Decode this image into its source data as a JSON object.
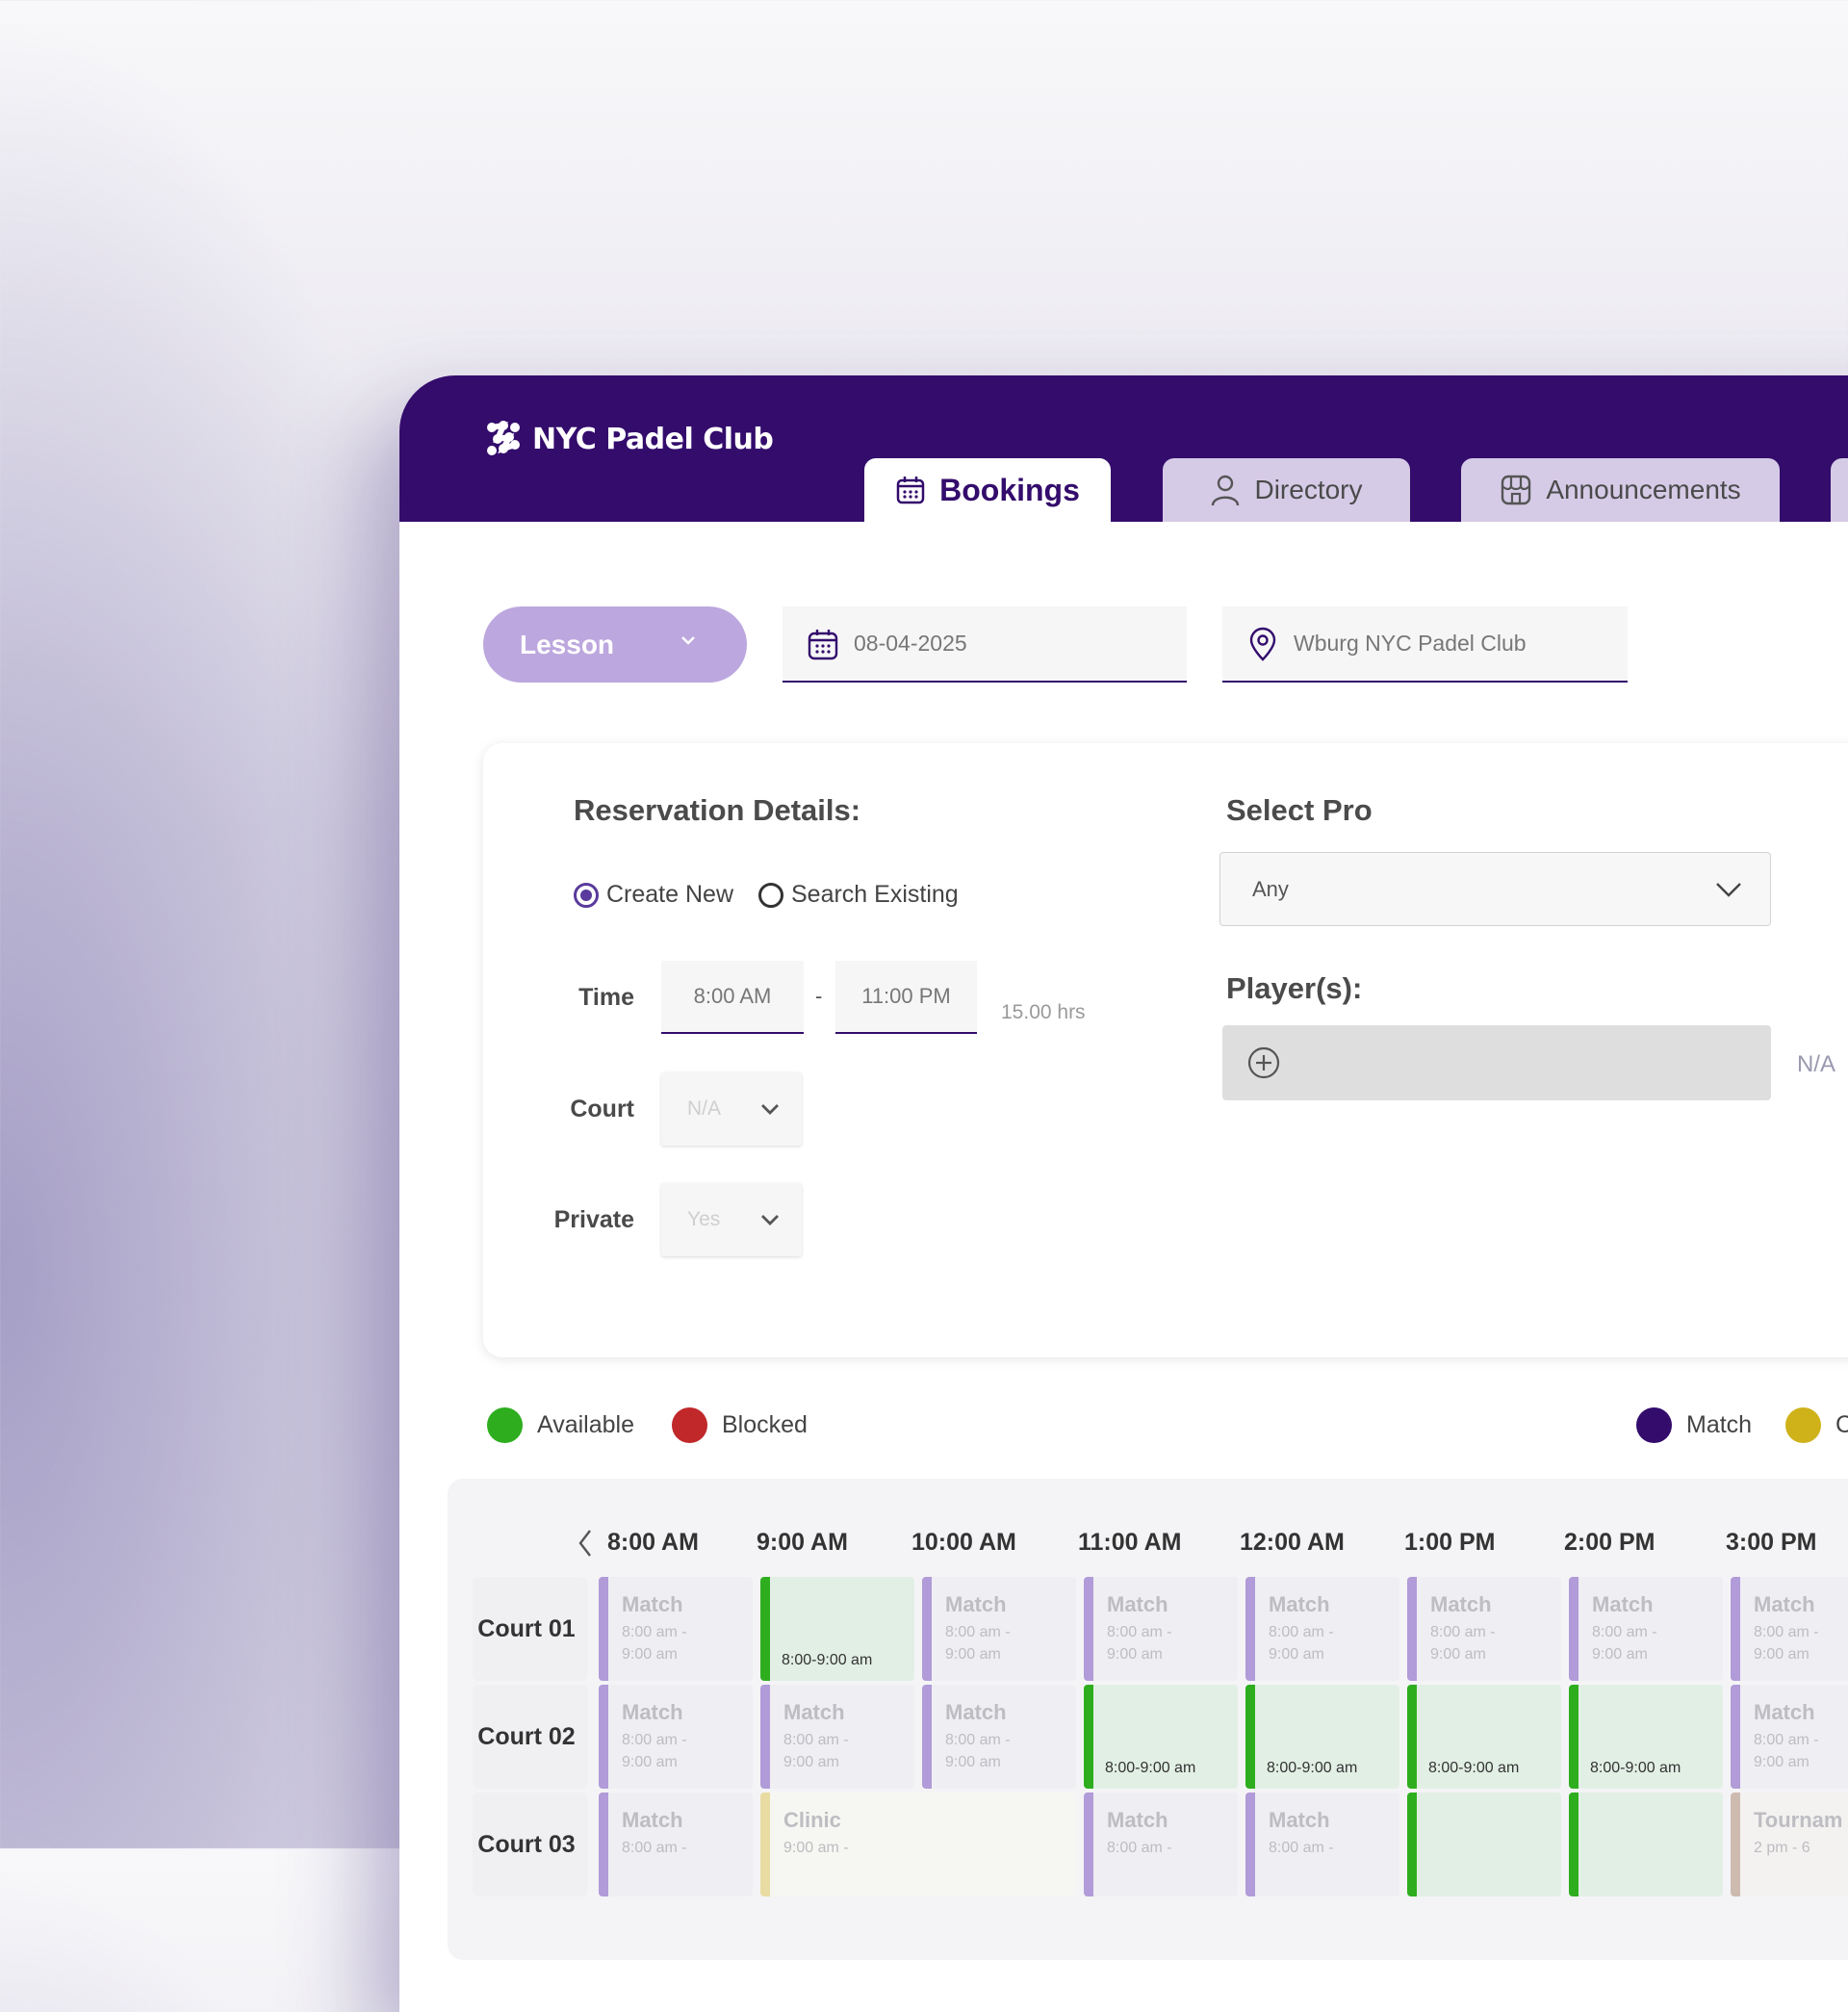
{
  "app": {
    "name": "NYC Padel Club"
  },
  "tabs": [
    {
      "label": "Bookings",
      "active": true,
      "icon": "calendar-icon"
    },
    {
      "label": "Directory",
      "active": false,
      "icon": "user-icon"
    },
    {
      "label": "Announcements",
      "active": false,
      "icon": "store-icon"
    }
  ],
  "filters": {
    "type": "Lesson",
    "date": "08-04-2025",
    "location": "Wburg NYC Padel Club"
  },
  "reservation": {
    "title": "Reservation Details:",
    "options": [
      "Create New",
      "Search Existing"
    ],
    "selected_option": "Create New",
    "time_label": "Time",
    "start_time": "8:00 AM",
    "separator": "-",
    "end_time": "11:00 PM",
    "duration": "15.00 hrs",
    "court_label": "Court",
    "court_value": "N/A",
    "private_label": "Private",
    "private_value": "Yes"
  },
  "pro": {
    "title": "Select Pro",
    "value": "Any"
  },
  "players": {
    "title": "Player(s):",
    "status": "N/A"
  },
  "legend": [
    {
      "label": "Available",
      "color": "#2eae1f"
    },
    {
      "label": "Blocked",
      "color": "#c0282a"
    },
    {
      "label": "Match",
      "color": "#330c6c"
    },
    {
      "label": "C",
      "color": "#cfb21a"
    }
  ],
  "schedule": {
    "times": [
      "8:00 AM",
      "9:00 AM",
      "10:00 AM",
      "11:00 AM",
      "12:00 AM",
      "1:00 PM",
      "2:00 PM",
      "3:00 PM"
    ],
    "courts": [
      {
        "name": "Court 01",
        "slots": [
          {
            "kind": "match",
            "title": "Match",
            "time": "8:00 am - 9:00 am"
          },
          {
            "kind": "avail",
            "time": "8:00-9:00 am"
          },
          {
            "kind": "match",
            "title": "Match",
            "time": "8:00 am - 9:00 am"
          },
          {
            "kind": "match",
            "title": "Match",
            "time": "8:00 am - 9:00 am"
          },
          {
            "kind": "match",
            "title": "Match",
            "time": "8:00 am - 9:00 am"
          },
          {
            "kind": "match",
            "title": "Match",
            "time": "8:00 am - 9:00 am"
          },
          {
            "kind": "match",
            "title": "Match",
            "time": "8:00 am - 9:00 am"
          },
          {
            "kind": "match",
            "title": "Match",
            "time": "8:00 am - 9:00 am"
          }
        ]
      },
      {
        "name": "Court 02",
        "slots": [
          {
            "kind": "match",
            "title": "Match",
            "time": "8:00 am - 9:00 am"
          },
          {
            "kind": "match",
            "title": "Match",
            "time": "8:00 am - 9:00 am"
          },
          {
            "kind": "match",
            "title": "Match",
            "time": "8:00 am - 9:00 am"
          },
          {
            "kind": "avail",
            "time": "8:00-9:00 am"
          },
          {
            "kind": "avail",
            "time": "8:00-9:00 am"
          },
          {
            "kind": "avail",
            "time": "8:00-9:00 am"
          },
          {
            "kind": "avail",
            "time": "8:00-9:00 am"
          },
          {
            "kind": "match",
            "title": "Match",
            "time": "8:00 am - 9:00 am"
          }
        ]
      },
      {
        "name": "Court 03",
        "slots": [
          {
            "kind": "match",
            "title": "Match",
            "time": "8:00 am -"
          },
          {
            "kind": "clinic",
            "title": "Clinic",
            "time": "9:00 am -",
            "span": 2
          },
          {
            "kind": "match",
            "title": "Match",
            "time": "8:00 am -"
          },
          {
            "kind": "match",
            "title": "Match",
            "time": "8:00 am -"
          },
          {
            "kind": "avail",
            "time": ""
          },
          {
            "kind": "avail",
            "time": ""
          },
          {
            "kind": "tourn",
            "title": "Tournam",
            "time": "2 pm - 6"
          }
        ]
      }
    ]
  }
}
